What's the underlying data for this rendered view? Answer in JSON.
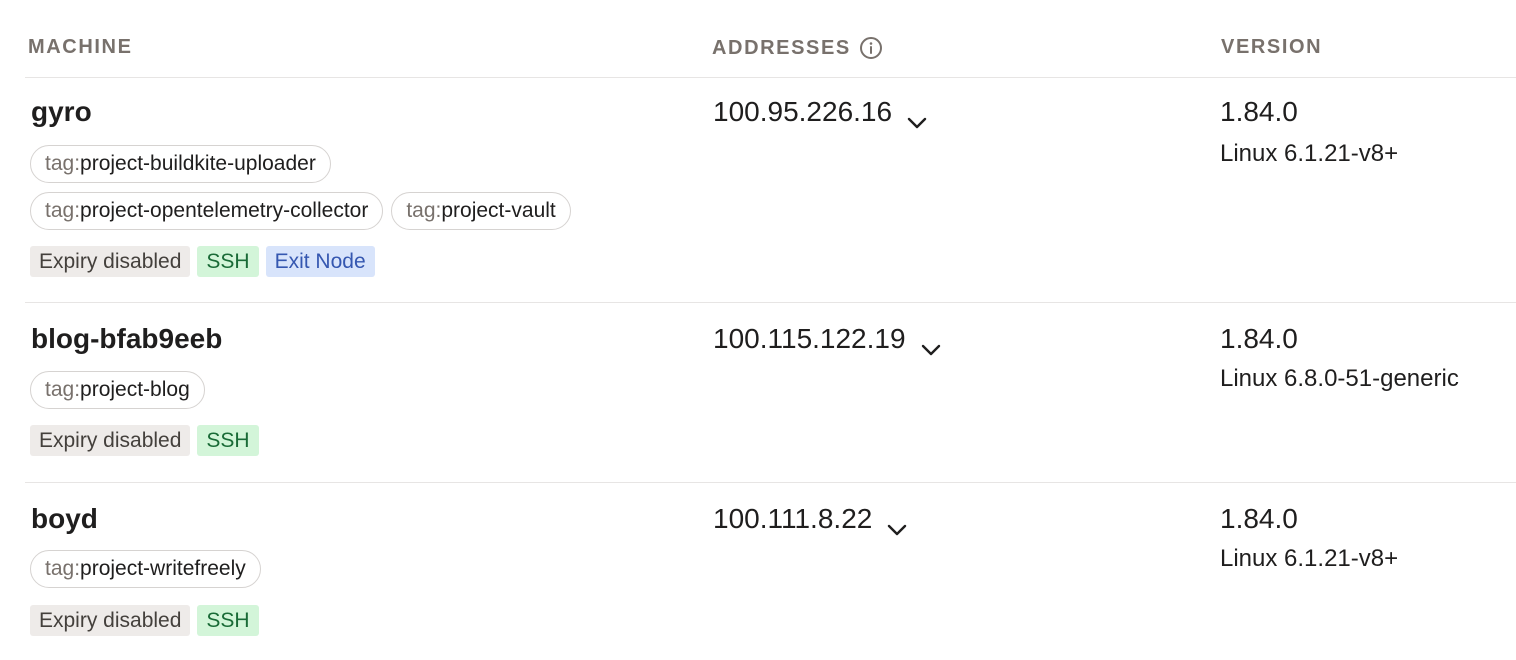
{
  "columns": {
    "machine": "MACHINE",
    "addresses": "ADDRESSES",
    "version": "VERSION"
  },
  "icons": {
    "addresses_info": "info-icon",
    "address_expand": "chevron-down-icon"
  },
  "colors": {
    "ssh_badge_bg": "#d3f5d9",
    "exit_node_badge_bg": "#d8e4fb",
    "expiry_badge_bg": "#eeebe9"
  },
  "machines": [
    {
      "name": "gyro",
      "tag_prefix": "tag:",
      "tags": [
        "project-buildkite-uploader",
        "project-opentelemetry-collector",
        "project-vault"
      ],
      "badges": [
        "Expiry disabled",
        "SSH",
        "Exit Node"
      ],
      "address": "100.95.226.16",
      "version": "1.84.0",
      "os": "Linux 6.1.21-v8+"
    },
    {
      "name": "blog-bfab9eeb",
      "tag_prefix": "tag:",
      "tags": [
        "project-blog"
      ],
      "badges": [
        "Expiry disabled",
        "SSH"
      ],
      "address": "100.115.122.19",
      "version": "1.84.0",
      "os": "Linux 6.8.0-51-generic"
    },
    {
      "name": "boyd",
      "tag_prefix": "tag:",
      "tags": [
        "project-writefreely"
      ],
      "badges": [
        "Expiry disabled",
        "SSH"
      ],
      "address": "100.111.8.22",
      "version": "1.84.0",
      "os": "Linux 6.1.21-v8+"
    }
  ]
}
